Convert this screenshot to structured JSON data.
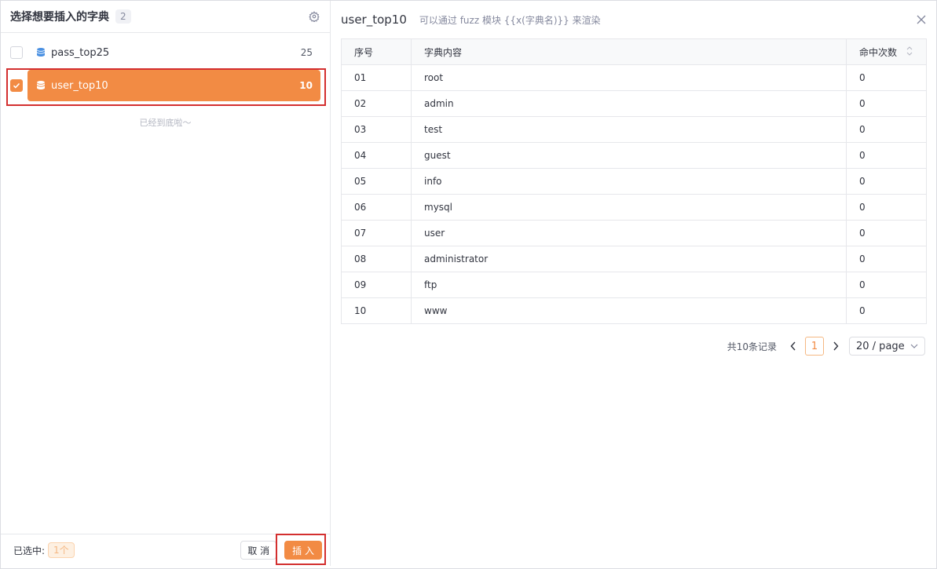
{
  "left": {
    "title": "选择想要插入的字典",
    "count": "2",
    "items": [
      {
        "name": "pass_top25",
        "num": "25",
        "checked": false,
        "selected": false
      },
      {
        "name": "user_top10",
        "num": "10",
        "checked": true,
        "selected": true
      }
    ],
    "end_text": "已经到底啦～",
    "footer": {
      "selected_label": "已选中:",
      "selected_count": "1个",
      "cancel": "取 消",
      "insert": "插 入"
    }
  },
  "right": {
    "title": "user_top10",
    "hint": "可以通过 fuzz 模块 {{x(字典名)}} 来渲染",
    "columns": [
      "序号",
      "字典内容",
      "命中次数"
    ],
    "rows": [
      [
        "01",
        "root",
        "0"
      ],
      [
        "02",
        "admin",
        "0"
      ],
      [
        "03",
        "test",
        "0"
      ],
      [
        "04",
        "guest",
        "0"
      ],
      [
        "05",
        "info",
        "0"
      ],
      [
        "06",
        "mysql",
        "0"
      ],
      [
        "07",
        "user",
        "0"
      ],
      [
        "08",
        "administrator",
        "0"
      ],
      [
        "09",
        "ftp",
        "0"
      ],
      [
        "10",
        "www",
        "0"
      ]
    ],
    "pager": {
      "total": "共10条记录",
      "current": "1",
      "page_size": "20 / page"
    }
  },
  "colors": {
    "accent": "#f28b44",
    "highlight": "#d32f2f"
  }
}
